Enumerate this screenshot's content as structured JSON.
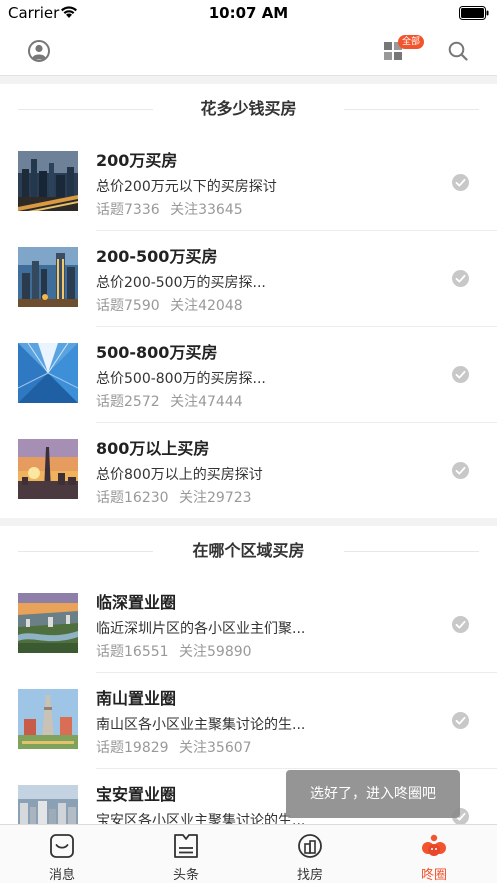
{
  "status_bar": {
    "carrier": "Carrier",
    "time": "10:07 AM"
  },
  "nav": {
    "badge": "全部",
    "icons": [
      "profile-icon",
      "grid-icon",
      "search-icon"
    ]
  },
  "sections": [
    {
      "title": "花多少钱买房",
      "items": [
        {
          "title": "200万买房",
          "desc": "总价200万元以下的买房探讨",
          "topics": "话题7336",
          "follows": "关注33645",
          "thumb": "city-night"
        },
        {
          "title": "200-500万买房",
          "desc": "总价200-500万的买房探...",
          "topics": "话题7590",
          "follows": "关注42048",
          "thumb": "city-dusk"
        },
        {
          "title": "500-800万买房",
          "desc": "总价500-800万的买房探...",
          "topics": "话题2572",
          "follows": "关注47444",
          "thumb": "glass-tower"
        },
        {
          "title": "800万以上买房",
          "desc": "总价800万以上的买房探讨",
          "topics": "话题16230",
          "follows": "关注29723",
          "thumb": "tower-sunset"
        }
      ]
    },
    {
      "title": "在哪个区域买房",
      "items": [
        {
          "title": "临深置业圈",
          "desc": "临近深圳片区的各小区业主们聚...",
          "topics": "话题16551",
          "follows": "关注59890",
          "thumb": "aerial-sunset"
        },
        {
          "title": "南山置业圈",
          "desc": "南山区各小区业主聚集讨论的生...",
          "topics": "话题19829",
          "follows": "关注35607",
          "thumb": "landmark"
        },
        {
          "title": "宝安置业圈",
          "desc": "宝安区各小区业主聚集讨论的生...",
          "topics": "",
          "follows": "",
          "thumb": "aerial-city"
        }
      ]
    }
  ],
  "toast": "选好了，进入咚圈吧",
  "tabs": [
    {
      "label": "消息",
      "icon": "message-icon"
    },
    {
      "label": "头条",
      "icon": "headlines-icon"
    },
    {
      "label": "找房",
      "icon": "find-house-icon"
    },
    {
      "label": "咚圈",
      "icon": "dong-circle-icon",
      "active": true
    }
  ],
  "colors": {
    "accent": "#f2542d",
    "check": "#c8c8c8"
  }
}
